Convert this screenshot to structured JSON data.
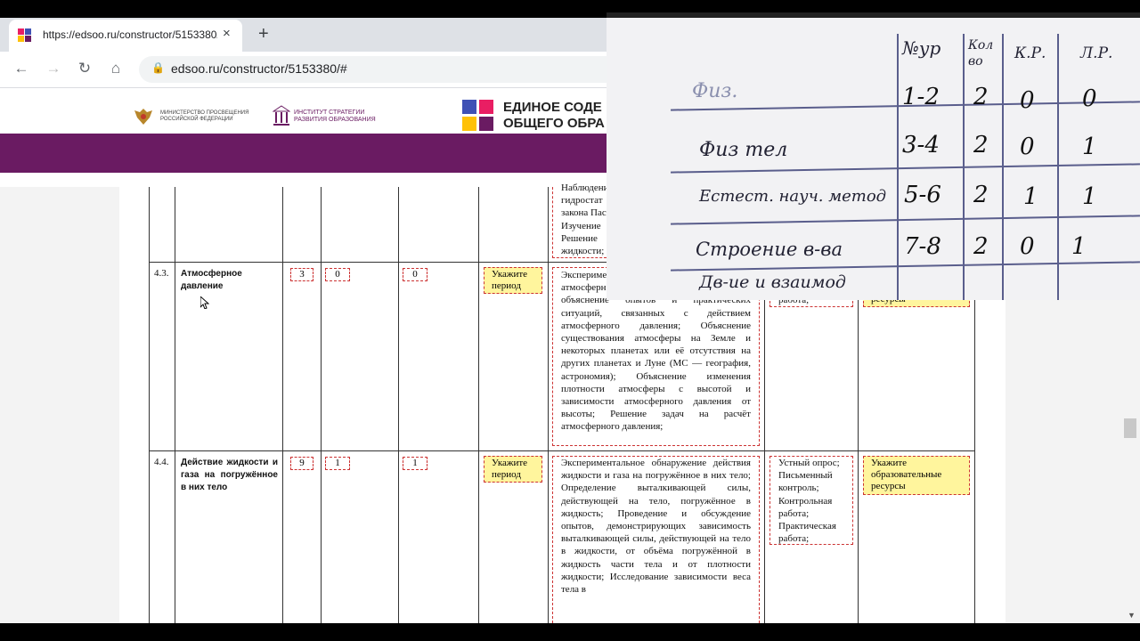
{
  "browser": {
    "tab_title": "https://edsoo.ru/constructor/5153380/#",
    "tab_close": "×",
    "new_tab": "+",
    "url": "edsoo.ru/constructor/5153380/#",
    "lock_icon": "🔒",
    "back": "←",
    "forward": "→",
    "reload": "↻",
    "home": "⌂"
  },
  "site": {
    "ministry": "МИНИСТЕРСТВО ПРОСВЕЩЕНИЯ РОССИЙСКОЙ ФЕДЕРАЦИИ",
    "institute": "ИНСТИТУТ СТРАТЕГИИ РАЗВИТИЯ ОБРАЗОВАНИЯ",
    "title_line1": "ЕДИНОЕ СОДЕ",
    "title_line2": "ОБЩЕГО ОБРА",
    "brand_color": "#6a1b62"
  },
  "table": {
    "top_row_text": [
      "Наблюдени",
      "гидростат",
      "закона Пас",
      "Изучение",
      "Решение",
      "жидкости;"
    ],
    "rows": [
      {
        "num": "4.3.",
        "title": "Атмосферное давление",
        "hours": "3",
        "kr": "0",
        "pr": "0",
        "period": "Укажите период",
        "activities": "Экспериментальное обнаружение атмосферного давления; Анализ и объяснение опытов и практических ситуаций, связанных с действием атмосферного давления; Объяснение существования атмосферы на Земле и некоторых планетах или её отсутствия на других планетах и Луне (МС — география, астрономия); Объяснение изменения плотности атмосферы с высотой и зависимости атмосферного давления от высоты; Решение задач на расчёт атмосферного давления;",
        "control": "работа;",
        "resources": "ресурсы"
      },
      {
        "num": "4.4.",
        "title": "Действие жидкости и газа на погружённое в них тело",
        "hours": "9",
        "kr": "1",
        "pr": "1",
        "period": "Укажите период",
        "activities": "Экспериментальное обнаружение действия жидкости и газа на погружённое в них тело; Определение выталкивающей силы, действующей на тело, погружённое в жидкость; Проведение и обсуждение опытов, демонстрирующих зависимость выталкивающей силы, действующей на тело в жидкости, от объёма погружённой в жидкость части тела и от плотности жидкости; Исследование зависимости веса тела в",
        "control": "Устный опрос; Письменный контроль; Контрольная работа; Практическая работа;",
        "resources": "Укажите образовательные ресурсы"
      }
    ]
  },
  "paper": {
    "headers": [
      "№ур",
      "Кол во",
      "К.Р.",
      "Л.Р."
    ],
    "rows": [
      {
        "topic": "Физ.",
        "lessons": "1-2",
        "count": "2",
        "kr": "0",
        "lr": "0"
      },
      {
        "topic": "Физ тел",
        "lessons": "3-4",
        "count": "2",
        "kr": "0",
        "lr": "1"
      },
      {
        "topic": "Естест. науч. метод",
        "lessons": "5-6",
        "count": "2",
        "kr": "1",
        "lr": "1"
      },
      {
        "topic": "Строение в-ва",
        "lessons": "7-8",
        "count": "2",
        "kr": "0",
        "lr": "1"
      },
      {
        "topic": "Дв-ие и взаимод",
        "lessons": "",
        "count": "",
        "kr": "",
        "lr": ""
      }
    ]
  }
}
